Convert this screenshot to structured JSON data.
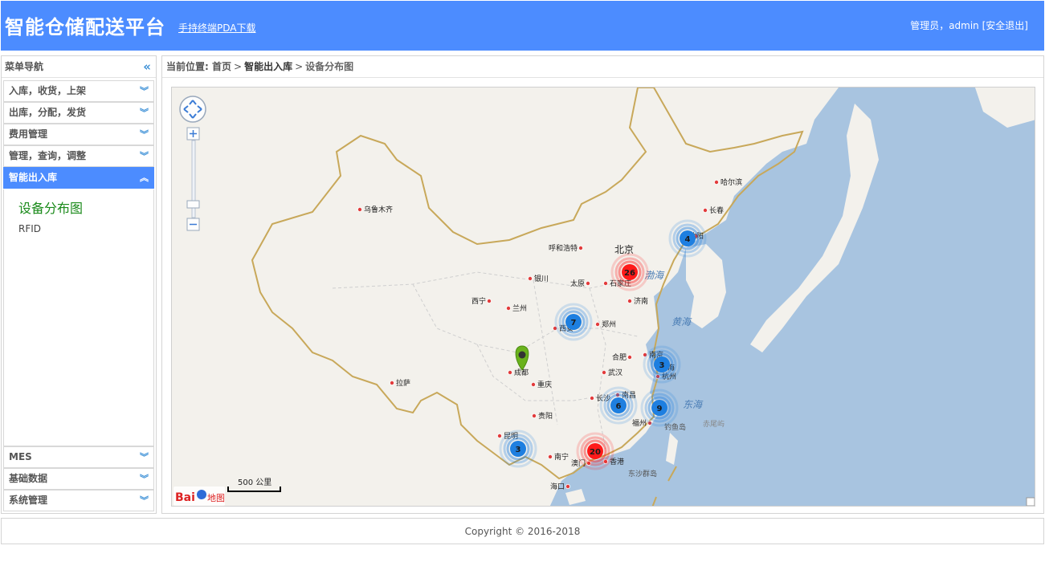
{
  "header": {
    "title": "智能仓储配送平台",
    "pda_link": "手持终端PDA下载",
    "user_text": "管理员，admin",
    "logout_label": "[安全退出]"
  },
  "sidebar": {
    "title": "菜单导航",
    "collapse_icon": "double-chevron-left-icon",
    "items": [
      {
        "label": "入库，收货，上架"
      },
      {
        "label": "出库，分配，发货"
      },
      {
        "label": "费用管理"
      },
      {
        "label": "管理，查询，调整"
      },
      {
        "label": "智能出入库",
        "active": true
      },
      {
        "label": "MES"
      },
      {
        "label": "基础数据"
      },
      {
        "label": "系统管理"
      }
    ],
    "sub_items": [
      {
        "label": "设备分布图",
        "selected": true
      },
      {
        "label": "RFID"
      }
    ]
  },
  "breadcrumb": {
    "prefix": "当前位置:",
    "home": "首页",
    "section": "智能出入库",
    "current": "设备分布图"
  },
  "map": {
    "logo_text": "Bai",
    "logo_suffix": "地图",
    "scale_label": "500 公里",
    "cities": [
      {
        "name": "哈尔滨"
      },
      {
        "name": "长春"
      },
      {
        "name": "乌鲁木齐"
      },
      {
        "name": "呼和浩特"
      },
      {
        "name": "北京"
      },
      {
        "name": "银川"
      },
      {
        "name": "石家庄"
      },
      {
        "name": "太原"
      },
      {
        "name": "济南"
      },
      {
        "name": "西宁"
      },
      {
        "name": "兰州"
      },
      {
        "name": "西安"
      },
      {
        "name": "郑州"
      },
      {
        "name": "合肥"
      },
      {
        "name": "南京"
      },
      {
        "name": "上海"
      },
      {
        "name": "成都"
      },
      {
        "name": "武汉"
      },
      {
        "name": "杭州"
      },
      {
        "name": "拉萨"
      },
      {
        "name": "重庆"
      },
      {
        "name": "长沙"
      },
      {
        "name": "南昌"
      },
      {
        "name": "贵阳"
      },
      {
        "name": "福州"
      },
      {
        "name": "昆明"
      },
      {
        "name": "南宁"
      },
      {
        "name": "澳门"
      },
      {
        "name": "香港"
      },
      {
        "name": "海口"
      },
      {
        "name": "沈阳"
      }
    ],
    "seas": [
      "渤海",
      "黄海",
      "东海"
    ],
    "islands": [
      "钓鱼岛",
      "赤尾屿",
      "东沙群岛"
    ],
    "clusters": [
      {
        "count": "26",
        "color": "#ff1a1a"
      },
      {
        "count": "4",
        "color": "#1e7fe0"
      },
      {
        "count": "7",
        "color": "#1e7fe0"
      },
      {
        "count": "3",
        "color": "#1e7fe0"
      },
      {
        "count": "6",
        "color": "#1e7fe0"
      },
      {
        "count": "9",
        "color": "#1e7fe0"
      },
      {
        "count": "3",
        "color": "#1e7fe0"
      },
      {
        "count": "20",
        "color": "#ff1a1a"
      }
    ]
  },
  "footer": {
    "copyright": "Copyright © 2016-2018"
  }
}
